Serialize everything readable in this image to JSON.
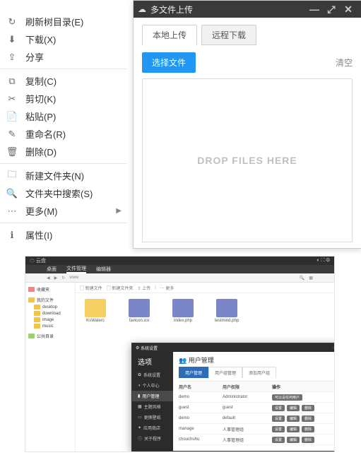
{
  "context_menu": {
    "groups": [
      [
        {
          "icon": "↻",
          "label": "刷新树目录(E)",
          "name": "ctx-refresh"
        },
        {
          "icon": "⬇",
          "label": "下载(X)",
          "name": "ctx-download"
        },
        {
          "icon": "⇪",
          "label": "分享",
          "name": "ctx-share"
        }
      ],
      [
        {
          "icon": "⧉",
          "label": "复制(C)",
          "name": "ctx-copy"
        },
        {
          "icon": "✂",
          "label": "剪切(K)",
          "name": "ctx-cut"
        },
        {
          "icon": "📄",
          "label": "粘贴(P)",
          "name": "ctx-paste"
        },
        {
          "icon": "✎",
          "label": "重命名(R)",
          "name": "ctx-rename"
        },
        {
          "icon": "🗑",
          "label": "删除(D)",
          "name": "ctx-delete"
        }
      ],
      [
        {
          "icon": "🗀",
          "label": "新建文件夹(N)",
          "name": "ctx-newfolder"
        },
        {
          "icon": "🔍",
          "label": "文件夹中搜索(S)",
          "name": "ctx-search"
        },
        {
          "icon": "⋯",
          "label": "更多(M)",
          "name": "ctx-more",
          "submenu": true
        }
      ],
      [
        {
          "icon": "ℹ",
          "label": "属性(I)",
          "name": "ctx-properties"
        }
      ]
    ]
  },
  "uploader": {
    "title": "多文件上传",
    "tabs": {
      "local": "本地上传",
      "remote": "远程下载"
    },
    "select_btn": "选择文件",
    "clear": "清空",
    "drop_hint": "DROP FILES HERE"
  },
  "composite": {
    "topbar": {
      "brand": "云盘"
    },
    "maintabs": [
      "桌面",
      "文件管理",
      "编辑器"
    ],
    "breadcrumb": [
      "www"
    ],
    "sidebar": {
      "fav_header": "收藏夹",
      "dir_header": "我的文件",
      "items": [
        "desktop",
        "download",
        "image",
        "music"
      ],
      "share_header": "公共目录"
    },
    "toolbar": {
      "items": [
        "新建文件",
        "新建文件夹",
        "上传",
        "更多"
      ]
    },
    "files": [
      {
        "name": "KsWaterc",
        "type": "folder"
      },
      {
        "name": "favicon.ico",
        "type": "php"
      },
      {
        "name": "index.php",
        "type": "php"
      },
      {
        "name": "testmind.php",
        "type": "php"
      }
    ],
    "sysdlg": {
      "title": "系统设置",
      "side_header": "选项",
      "side_items": [
        "系统设置",
        "个人中心",
        "用户管理",
        "主题风格",
        "更换壁纸",
        "应用商店",
        "关于程序"
      ],
      "main_title": "用户管理",
      "subtabs": [
        "用户管理",
        "用户组管理",
        "添加用户组"
      ],
      "table": {
        "headers": [
          "用户名",
          "用户权限",
          "操作"
        ],
        "rows": [
          {
            "user": "demo",
            "role": "Administrator",
            "ops": [
              "可以设任何用户"
            ]
          },
          {
            "user": "guest",
            "role": "guest",
            "ops": [
              "设置",
              "编辑",
              "删除"
            ]
          },
          {
            "user": "demo",
            "role": "default",
            "ops": [
              "设置",
              "编辑",
              "删除"
            ]
          },
          {
            "user": "manage",
            "role": "人事管理组",
            "ops": [
              "设置",
              "编辑",
              "删除"
            ]
          },
          {
            "user": "chouchuhu",
            "role": "人事管理组",
            "ops": [
              "设置",
              "编辑",
              "删除"
            ]
          }
        ]
      }
    }
  }
}
